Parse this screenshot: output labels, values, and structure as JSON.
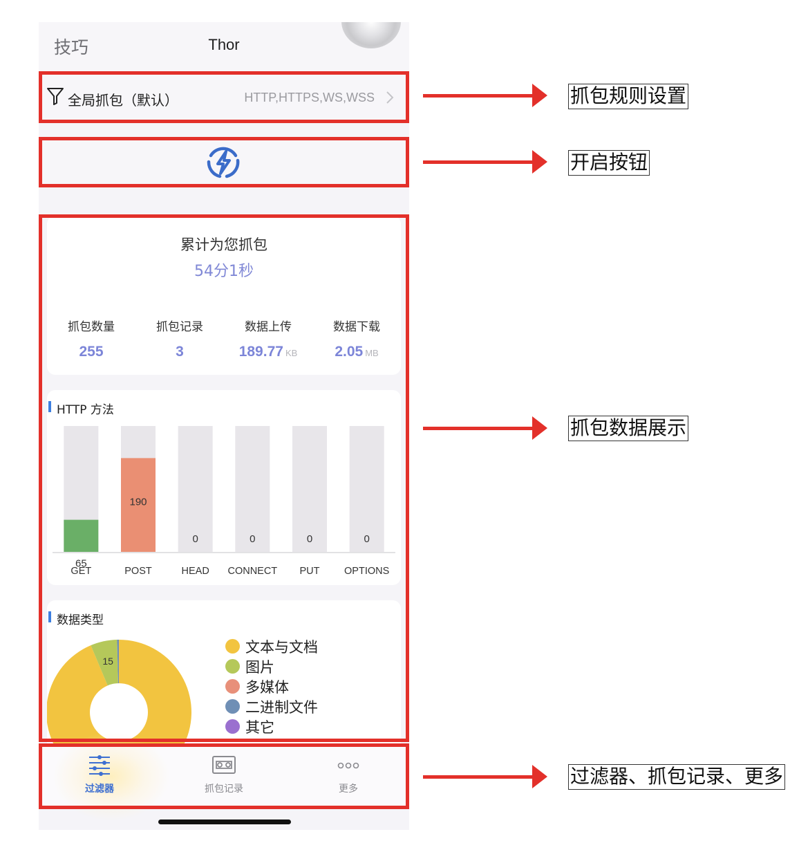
{
  "header": {
    "left": "技巧",
    "title": "Thor"
  },
  "filter": {
    "label": "全局抓包（默认）",
    "protocols": "HTTP,HTTPS,WS,WSS"
  },
  "summary": {
    "caption": "累计为您抓包",
    "duration": "54分1秒",
    "stats": [
      {
        "label": "抓包数量",
        "value": "255",
        "unit": ""
      },
      {
        "label": "抓包记录",
        "value": "3",
        "unit": ""
      },
      {
        "label": "数据上传",
        "value": "189.77",
        "unit": "KB"
      },
      {
        "label": "数据下载",
        "value": "2.05",
        "unit": "MB"
      }
    ]
  },
  "http_section": {
    "title": "HTTP 方法"
  },
  "type_section": {
    "title": "数据类型",
    "legend": [
      {
        "name": "文本与文档",
        "color": "#f2c440"
      },
      {
        "name": "图片",
        "color": "#b5c85a"
      },
      {
        "name": "多媒体",
        "color": "#e8907a"
      },
      {
        "name": "二进制文件",
        "color": "#6f8fb5"
      },
      {
        "name": "其它",
        "color": "#9a70cf"
      }
    ]
  },
  "chart_data": [
    {
      "type": "bar",
      "title": "HTTP 方法",
      "categories": [
        "GET",
        "POST",
        "HEAD",
        "CONNECT",
        "PUT",
        "OPTIONS"
      ],
      "values": [
        65,
        190,
        0,
        0,
        0,
        0
      ],
      "colors": [
        "#6aaf67",
        "#ea8f73",
        "#e6e3e8",
        "#e6e3e8",
        "#e6e3e8",
        "#e6e3e8"
      ],
      "ylim": [
        0,
        255
      ]
    },
    {
      "type": "pie",
      "title": "数据类型",
      "labels": [
        "文本与文档",
        "图片",
        "多媒体",
        "二进制文件",
        "其它"
      ],
      "values": [
        237,
        15,
        0,
        1,
        0
      ],
      "shown_labels": [
        "",
        "15",
        "",
        "",
        ""
      ]
    }
  ],
  "tabs": [
    {
      "label": "过滤器",
      "icon": "filter-sliders-icon",
      "active": true
    },
    {
      "label": "抓包记录",
      "icon": "cassette-icon",
      "active": false
    },
    {
      "label": "更多",
      "icon": "more-dots-icon",
      "active": false
    }
  ],
  "annotations": [
    "抓包规则设置",
    "开启按钮",
    "抓包数据展示",
    "过滤器、抓包记录、更多"
  ],
  "colors": {
    "highlight": "#e3302a",
    "accent": "#3d6fd1",
    "value": "#7c85d8"
  }
}
